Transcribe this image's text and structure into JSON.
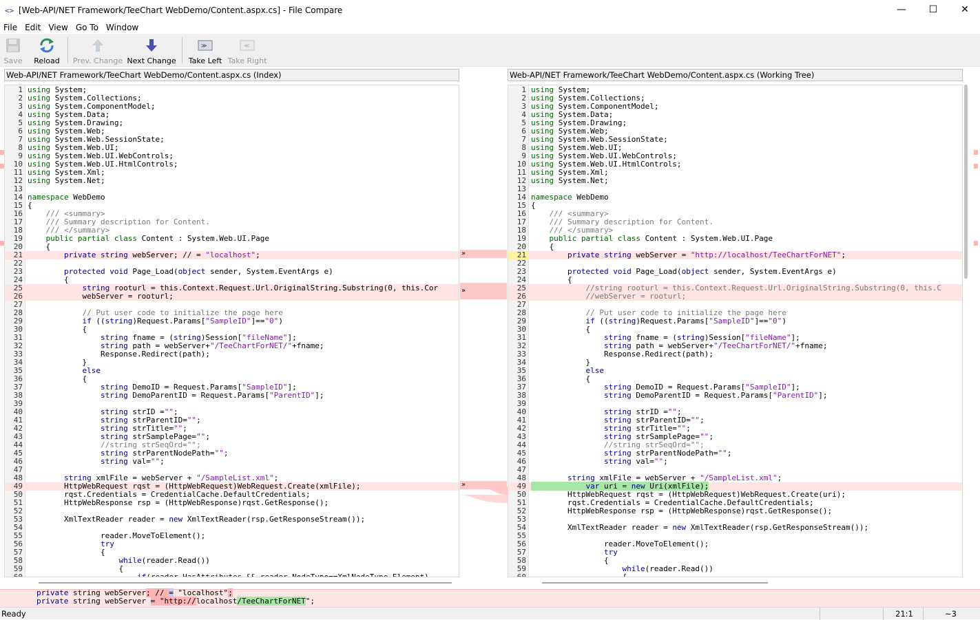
{
  "window": {
    "title": "[Web-API/NET Framework/TeeChart WebDemo/Content.aspx.cs] - File Compare",
    "icon": "code-brackets-icon",
    "controls": [
      "—",
      "☐",
      "✕"
    ]
  },
  "menu": [
    "File",
    "Edit",
    "View",
    "Go To",
    "Window"
  ],
  "toolbar": {
    "save": "Save",
    "reload": "Reload",
    "prev_change": "Prev. Change",
    "next_change": "Next Change",
    "take_left": "Take Left",
    "take_right": "Take Right"
  },
  "left_pane": {
    "header": "Web-API/NET Framework/TeeChart WebDemo/Content.aspx.cs (Index)"
  },
  "right_pane": {
    "header": "Web-API/NET Framework/TeeChart WebDemo/Content.aspx.cs (Working Tree)"
  },
  "left_lines": [
    {
      "n": "1",
      "t": "using System;"
    },
    {
      "n": "2",
      "t": "using System.Collections;"
    },
    {
      "n": "3",
      "t": "using System.ComponentModel;"
    },
    {
      "n": "4",
      "t": "using System.Data;"
    },
    {
      "n": "5",
      "t": "using System.Drawing;"
    },
    {
      "n": "6",
      "t": "using System.Web;"
    },
    {
      "n": "7",
      "t": "using System.Web.SessionState;"
    },
    {
      "n": "8",
      "t": "using System.Web.UI;"
    },
    {
      "n": "9",
      "t": "using System.Web.UI.WebControls;"
    },
    {
      "n": "10",
      "t": "using System.Web.UI.HtmlControls;"
    },
    {
      "n": "11",
      "t": "using System.Xml;"
    },
    {
      "n": "12",
      "t": "using System.Net;"
    },
    {
      "n": "13",
      "t": ""
    },
    {
      "n": "14",
      "t": "namespace WebDemo"
    },
    {
      "n": "15",
      "t": "{"
    },
    {
      "n": "16",
      "t": "    /// <summary>"
    },
    {
      "n": "17",
      "t": "    /// Summary description for Content."
    },
    {
      "n": "18",
      "t": "    /// </summary>"
    },
    {
      "n": "19",
      "t": "    public partial class Content : System.Web.UI.Page"
    },
    {
      "n": "20",
      "t": "    {"
    },
    {
      "n": "21",
      "t": "        private string webServer; // = \"localhost\";"
    },
    {
      "n": "22",
      "t": ""
    },
    {
      "n": "23",
      "t": "        protected void Page_Load(object sender, System.EventArgs e)"
    },
    {
      "n": "24",
      "t": "        {"
    },
    {
      "n": "25",
      "t": "            string rooturl = this.Context.Request.Url.OriginalString.Substring(0, this.Cor"
    },
    {
      "n": "26",
      "t": "            webServer = rooturl;"
    },
    {
      "n": "27",
      "t": ""
    },
    {
      "n": "28",
      "t": "            // Put user code to initialize the page here"
    },
    {
      "n": "29",
      "t": "            if ((string)Request.Params[\"SampleID\"]==\"0\")"
    },
    {
      "n": "30",
      "t": "            {"
    },
    {
      "n": "31",
      "t": "                string fname = (string)Session[\"fileName\"];"
    },
    {
      "n": "32",
      "t": "                string path = webServer+\"/TeeChartForNET/\"+fname;"
    },
    {
      "n": "33",
      "t": "                Response.Redirect(path);"
    },
    {
      "n": "34",
      "t": "            }"
    },
    {
      "n": "35",
      "t": "            else"
    },
    {
      "n": "36",
      "t": "            {"
    },
    {
      "n": "37",
      "t": "                string DemoID = Request.Params[\"SampleID\"];"
    },
    {
      "n": "38",
      "t": "                string DemoParentID = Request.Params[\"ParentID\"];"
    },
    {
      "n": "39",
      "t": ""
    },
    {
      "n": "40",
      "t": "                string strID =\"\";"
    },
    {
      "n": "41",
      "t": "                string strParentID=\"\";"
    },
    {
      "n": "42",
      "t": "                string strTitle=\"\";"
    },
    {
      "n": "43",
      "t": "                string strSamplePage=\"\";"
    },
    {
      "n": "44",
      "t": "                //string strSeqOrd=\"\";"
    },
    {
      "n": "45",
      "t": "                string strParentNodePath=\"\";"
    },
    {
      "n": "46",
      "t": "                string val=\"\";"
    },
    {
      "n": "47",
      "t": ""
    },
    {
      "n": "48",
      "t": "        string xmlFile = webServer + \"/SampleList.xml\";"
    },
    {
      "n": "49",
      "t": "        HttpWebRequest rqst = (HttpWebRequest)WebRequest.Create(xmlFile);"
    },
    {
      "n": "50",
      "t": "        rqst.Credentials = CredentialCache.DefaultCredentials;"
    },
    {
      "n": "51",
      "t": "        HttpWebResponse rsp = (HttpWebResponse)rqst.GetResponse();"
    },
    {
      "n": "52",
      "t": ""
    },
    {
      "n": "53",
      "t": "        XmlTextReader reader = new XmlTextReader(rsp.GetResponseStream());"
    },
    {
      "n": "54",
      "t": ""
    },
    {
      "n": "55",
      "t": "                reader.MoveToElement();"
    },
    {
      "n": "56",
      "t": "                try"
    },
    {
      "n": "57",
      "t": "                {"
    },
    {
      "n": "58",
      "t": "                    while(reader.Read())"
    },
    {
      "n": "59",
      "t": "                    {"
    },
    {
      "n": "60",
      "t": "                        if(reader.HasAttributes && reader.NodeType==XmlNodeType.Element)"
    }
  ],
  "right_lines": [
    {
      "n": "1",
      "t": "using System;"
    },
    {
      "n": "2",
      "t": "using System.Collections;"
    },
    {
      "n": "3",
      "t": "using System.ComponentModel;"
    },
    {
      "n": "4",
      "t": "using System.Data;"
    },
    {
      "n": "5",
      "t": "using System.Drawing;"
    },
    {
      "n": "6",
      "t": "using System.Web;"
    },
    {
      "n": "7",
      "t": "using System.Web.SessionState;"
    },
    {
      "n": "8",
      "t": "using System.Web.UI;"
    },
    {
      "n": "9",
      "t": "using System.Web.UI.WebControls;"
    },
    {
      "n": "10",
      "t": "using System.Web.UI.HtmlControls;"
    },
    {
      "n": "11",
      "t": "using System.Xml;"
    },
    {
      "n": "12",
      "t": "using System.Net;"
    },
    {
      "n": "13",
      "t": ""
    },
    {
      "n": "14",
      "t": "namespace WebDemo"
    },
    {
      "n": "15",
      "t": "{"
    },
    {
      "n": "16",
      "t": "    /// <summary>"
    },
    {
      "n": "17",
      "t": "    /// Summary description for Content."
    },
    {
      "n": "18",
      "t": "    /// </summary>"
    },
    {
      "n": "19",
      "t": "    public partial class Content : System.Web.UI.Page"
    },
    {
      "n": "20",
      "t": "    {"
    },
    {
      "n": "21",
      "t": "        private string webServer = \"http://localhost/TeeChartForNET\";"
    },
    {
      "n": "22",
      "t": ""
    },
    {
      "n": "23",
      "t": "        protected void Page_Load(object sender, System.EventArgs e)"
    },
    {
      "n": "24",
      "t": "        {"
    },
    {
      "n": "25",
      "t": "            //string rooturl = this.Context.Request.Url.OriginalString.Substring(0, this.C"
    },
    {
      "n": "26",
      "t": "            //webServer = rooturl;"
    },
    {
      "n": "27",
      "t": ""
    },
    {
      "n": "28",
      "t": "            // Put user code to initialize the page here"
    },
    {
      "n": "29",
      "t": "            if ((string)Request.Params[\"SampleID\"]==\"0\")"
    },
    {
      "n": "30",
      "t": "            {"
    },
    {
      "n": "31",
      "t": "                string fname = (string)Session[\"fileName\"];"
    },
    {
      "n": "32",
      "t": "                string path = webServer+\"/TeeChartForNET/\"+fname;"
    },
    {
      "n": "33",
      "t": "                Response.Redirect(path);"
    },
    {
      "n": "34",
      "t": "            }"
    },
    {
      "n": "35",
      "t": "            else"
    },
    {
      "n": "36",
      "t": "            {"
    },
    {
      "n": "37",
      "t": "                string DemoID = Request.Params[\"SampleID\"];"
    },
    {
      "n": "38",
      "t": "                string DemoParentID = Request.Params[\"ParentID\"];"
    },
    {
      "n": "39",
      "t": ""
    },
    {
      "n": "40",
      "t": "                string strID =\"\";"
    },
    {
      "n": "41",
      "t": "                string strParentID=\"\";"
    },
    {
      "n": "42",
      "t": "                string strTitle=\"\";"
    },
    {
      "n": "43",
      "t": "                string strSamplePage=\"\";"
    },
    {
      "n": "44",
      "t": "                //string strSeqOrd=\"\";"
    },
    {
      "n": "45",
      "t": "                string strParentNodePath=\"\";"
    },
    {
      "n": "46",
      "t": "                string val=\"\";"
    },
    {
      "n": "47",
      "t": ""
    },
    {
      "n": "48",
      "t": "        string xmlFile = webServer + \"/SampleList.xml\";"
    },
    {
      "n": "49",
      "t": "            var uri = new Uri(xmlFile);"
    },
    {
      "n": "50",
      "t": "        HttpWebRequest rqst = (HttpWebRequest)WebRequest.Create(uri);"
    },
    {
      "n": "51",
      "t": "        rqst.Credentials = CredentialCache.DefaultCredentials;"
    },
    {
      "n": "52",
      "t": "        HttpWebResponse rsp = (HttpWebResponse)rqst.GetResponse();"
    },
    {
      "n": "53",
      "t": ""
    },
    {
      "n": "54",
      "t": "        XmlTextReader reader = new XmlTextReader(rsp.GetResponseStream());"
    },
    {
      "n": "55",
      "t": ""
    },
    {
      "n": "56",
      "t": "                reader.MoveToElement();"
    },
    {
      "n": "57",
      "t": "                try"
    },
    {
      "n": "58",
      "t": "                {"
    },
    {
      "n": "59",
      "t": "                    while(reader.Read())"
    },
    {
      "n": "60",
      "t": "                    {"
    }
  ],
  "bottom_compare": {
    "line_left": "private string webServer; // = \"localhost\";",
    "line_right": "private string webServer = \"http://localhost/TeeChartForNET\";"
  },
  "change_arrow": "»",
  "status": {
    "text": "Ready",
    "position": "21:1",
    "changes": "~3"
  }
}
